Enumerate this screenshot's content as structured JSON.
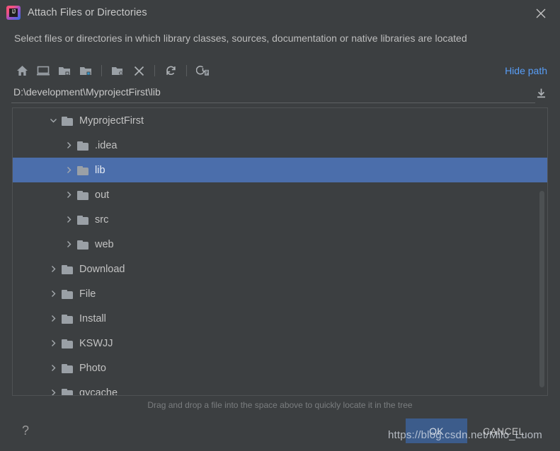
{
  "window": {
    "title": "Attach Files or Directories",
    "app_icon": "intellij-idea-icon",
    "close_icon": "close-icon",
    "icon_letters": "IJ"
  },
  "description": "Select files or directories in which library classes, sources, documentation or native libraries are located",
  "toolbar": {
    "buttons": [
      {
        "name": "home-icon",
        "tooltip": "Home"
      },
      {
        "name": "desktop-icon",
        "tooltip": "Desktop"
      },
      {
        "name": "project-folder-icon",
        "tooltip": "Project Directory"
      },
      {
        "name": "module-folder-icon",
        "tooltip": "Module Directory"
      },
      {
        "name": "new-folder-icon",
        "tooltip": "New Folder"
      },
      {
        "name": "delete-icon",
        "tooltip": "Delete"
      },
      {
        "name": "refresh-icon",
        "tooltip": "Refresh"
      },
      {
        "name": "recent-history-icon",
        "tooltip": "Recent"
      }
    ],
    "hide_path_label": "Hide path"
  },
  "path_field": {
    "value": "D:\\development\\MyprojectFirst\\lib",
    "download_icon": "download-arrow-icon"
  },
  "tree": {
    "items": [
      {
        "label": "MyprojectFirst",
        "indent": 1,
        "expanded": true,
        "selected": false
      },
      {
        "label": ".idea",
        "indent": 2,
        "expanded": false,
        "selected": false
      },
      {
        "label": "lib",
        "indent": 2,
        "expanded": false,
        "selected": true
      },
      {
        "label": "out",
        "indent": 2,
        "expanded": false,
        "selected": false
      },
      {
        "label": "src",
        "indent": 2,
        "expanded": false,
        "selected": false
      },
      {
        "label": "web",
        "indent": 2,
        "expanded": false,
        "selected": false
      },
      {
        "label": "Download",
        "indent": 1,
        "expanded": false,
        "selected": false
      },
      {
        "label": "File",
        "indent": 1,
        "expanded": false,
        "selected": false
      },
      {
        "label": "Install",
        "indent": 1,
        "expanded": false,
        "selected": false
      },
      {
        "label": "KSWJJ",
        "indent": 1,
        "expanded": false,
        "selected": false
      },
      {
        "label": "Photo",
        "indent": 1,
        "expanded": false,
        "selected": false
      },
      {
        "label": "qycache",
        "indent": 1,
        "expanded": false,
        "selected": false
      }
    ]
  },
  "hint": "Drag and drop a file into the space above to quickly locate it in the tree",
  "footer": {
    "help_label": "?",
    "ok_label": "OK",
    "cancel_label": "CANCEL"
  },
  "watermark": "https://blog.csdn.net/Milo_Luom",
  "colors": {
    "background": "#3C3F41",
    "selection": "#4B6EAB",
    "link": "#589DF6",
    "default_button": "#3C5C8B",
    "text": "#BBBBBB",
    "folder": "#9AA0A6"
  }
}
